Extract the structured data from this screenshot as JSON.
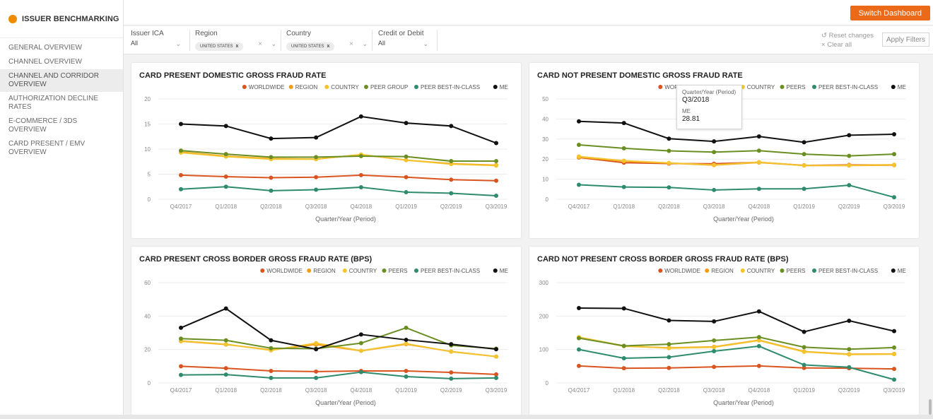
{
  "brand": {
    "label": "ISSUER BENCHMARKING",
    "color": "#f08a00"
  },
  "sidebar": {
    "items": [
      {
        "label": "GENERAL OVERVIEW"
      },
      {
        "label": "CHANNEL OVERVIEW"
      },
      {
        "label": "CHANNEL AND CORRIDOR OVERVIEW",
        "active": true
      },
      {
        "label": "AUTHORIZATION DECLINE RATES"
      },
      {
        "label": "E-COMMERCE / 3DS OVERVIEW"
      },
      {
        "label": "CARD PRESENT / EMV OVERVIEW"
      }
    ]
  },
  "header": {
    "switch_label": "Switch Dashboard",
    "accent": "#ea6a1a"
  },
  "filters": {
    "issuer_ica": {
      "label": "Issuer ICA",
      "value": "All"
    },
    "region": {
      "label": "Region",
      "chip": "UNITED STATES"
    },
    "country": {
      "label": "Country",
      "chip": "UNITED STATES"
    },
    "credit_debit": {
      "label": "Credit or Debit",
      "value": "All"
    },
    "reset_label": "Reset changes",
    "clear_label": "Clear all",
    "apply_label": "Apply Filters"
  },
  "series_colors": {
    "WORLDWIDE": "#d9541e",
    "REGION": "#f39c12",
    "COUNTRY": "#f4c430",
    "PEER GROUP": "#6b8e23",
    "PEERS": "#6b8e23",
    "PEER BEST-IN-CLASS": "#2e8b6e",
    "ME": "#111111"
  },
  "tooltip": {
    "header": "Quarter/Year (Period)",
    "period": "Q3/2018",
    "series": "ME",
    "value": "28.81"
  },
  "chart_data": [
    {
      "type": "line",
      "title": "CARD PRESENT DOMESTIC GROSS FRAUD RATE",
      "xlabel": "Quarter/Year (Period)",
      "ylabel": "",
      "ylim": [
        0,
        20
      ],
      "yticks": [
        0,
        5,
        10,
        15,
        20
      ],
      "categories": [
        "Q4/2017",
        "Q1/2018",
        "Q2/2018",
        "Q3/2018",
        "Q4/2018",
        "Q1/2019",
        "Q2/2019",
        "Q3/2019"
      ],
      "series": [
        {
          "name": "WORLDWIDE",
          "values": [
            4.8,
            4.5,
            4.3,
            4.4,
            4.8,
            4.4,
            3.9,
            3.7
          ]
        },
        {
          "name": "REGION",
          "values": [
            9.4,
            8.6,
            8.1,
            8.0,
            8.9,
            7.8,
            7.1,
            6.8
          ]
        },
        {
          "name": "COUNTRY",
          "values": [
            9.3,
            8.5,
            8.0,
            8.0,
            8.9,
            7.8,
            7.0,
            6.7
          ]
        },
        {
          "name": "PEER GROUP",
          "values": [
            9.7,
            9.0,
            8.4,
            8.4,
            8.6,
            8.5,
            7.6,
            7.6
          ]
        },
        {
          "name": "PEER BEST-IN-CLASS",
          "values": [
            2.0,
            2.5,
            1.7,
            1.9,
            2.4,
            1.4,
            1.2,
            0.7
          ]
        },
        {
          "name": "ME",
          "values": [
            15.0,
            14.6,
            12.1,
            12.3,
            16.5,
            15.2,
            14.6,
            11.2
          ]
        }
      ]
    },
    {
      "type": "line",
      "title": "CARD NOT PRESENT DOMESTIC GROSS FRAUD RATE",
      "xlabel": "Quarter/Year (Period)",
      "ylabel": "",
      "ylim": [
        0,
        50
      ],
      "yticks": [
        0,
        10,
        20,
        30,
        40,
        50
      ],
      "categories": [
        "Q4/2017",
        "Q1/2018",
        "Q2/2018",
        "Q3/2018",
        "Q4/2018",
        "Q1/2019",
        "Q2/2019",
        "Q3/2019"
      ],
      "series": [
        {
          "name": "WORLDWIDE",
          "values": [
            20.8,
            18.2,
            17.8,
            17.7,
            18.4,
            16.9,
            17.1,
            17.1
          ]
        },
        {
          "name": "REGION",
          "values": [
            21.0,
            19.0,
            18.0,
            17.0,
            18.3,
            16.8,
            16.8,
            17.0
          ]
        },
        {
          "name": "COUNTRY",
          "values": [
            21.3,
            19.2,
            18.1,
            17.1,
            18.5,
            16.8,
            16.9,
            17.2
          ]
        },
        {
          "name": "PEERS",
          "values": [
            27.1,
            25.4,
            24.1,
            23.5,
            24.2,
            22.5,
            21.6,
            22.5
          ]
        },
        {
          "name": "PEER BEST-IN-CLASS",
          "values": [
            7.2,
            6.1,
            5.9,
            4.6,
            5.2,
            5.2,
            7.0,
            1.0
          ]
        },
        {
          "name": "ME",
          "values": [
            38.8,
            38.0,
            30.2,
            28.81,
            31.3,
            28.4,
            31.9,
            32.4
          ]
        }
      ]
    },
    {
      "type": "line",
      "title": "CARD PRESENT CROSS BORDER GROSS FRAUD RATE (BPS)",
      "xlabel": "Quarter/Year (Period)",
      "ylabel": "",
      "ylim": [
        0,
        60
      ],
      "yticks": [
        0,
        20,
        40,
        60
      ],
      "categories": [
        "Q4/2017",
        "Q1/2018",
        "Q2/2018",
        "Q3/2018",
        "Q4/2018",
        "Q1/2019",
        "Q2/2019",
        "Q3/2019"
      ],
      "series": [
        {
          "name": "WORLDWIDE",
          "values": [
            10.0,
            8.8,
            7.2,
            6.8,
            7.2,
            7.2,
            6.3,
            5.1
          ]
        },
        {
          "name": "REGION",
          "values": [
            25.0,
            23.0,
            19.8,
            23.0,
            19.2,
            23.2,
            18.8,
            15.8
          ]
        },
        {
          "name": "COUNTRY",
          "values": [
            25.2,
            23.2,
            19.5,
            23.8,
            19.3,
            23.5,
            18.7,
            15.8
          ]
        },
        {
          "name": "PEERS",
          "values": [
            26.5,
            25.5,
            20.8,
            20.5,
            23.8,
            33.0,
            22.5,
            20.5
          ]
        },
        {
          "name": "PEER BEST-IN-CLASS",
          "values": [
            4.8,
            5.0,
            3.0,
            3.0,
            6.5,
            3.8,
            2.6,
            3.0
          ]
        },
        {
          "name": "ME",
          "values": [
            33.0,
            44.5,
            25.5,
            20.2,
            29.0,
            25.8,
            23.2,
            20.2
          ]
        }
      ]
    },
    {
      "type": "line",
      "title": "CARD NOT PRESENT CROSS BORDER GROSS FRAUD RATE (BPS)",
      "xlabel": "Quarter/Year (Period)",
      "ylabel": "",
      "ylim": [
        0,
        300
      ],
      "yticks": [
        0,
        100,
        200,
        300
      ],
      "categories": [
        "Q4/2017",
        "Q1/2018",
        "Q2/2018",
        "Q3/2018",
        "Q4/2018",
        "Q1/2019",
        "Q2/2019",
        "Q3/2019"
      ],
      "series": [
        {
          "name": "WORLDWIDE",
          "values": [
            51,
            44,
            45,
            48,
            51,
            45,
            44,
            42
          ]
        },
        {
          "name": "REGION",
          "values": [
            136,
            110,
            105,
            108,
            128,
            94,
            86,
            87
          ]
        },
        {
          "name": "COUNTRY",
          "values": [
            137,
            111,
            104,
            107,
            127,
            93,
            85,
            86
          ]
        },
        {
          "name": "PEERS",
          "values": [
            134,
            111,
            116,
            127,
            137,
            107,
            101,
            106
          ]
        },
        {
          "name": "PEER BEST-IN-CLASS",
          "values": [
            100,
            74,
            77,
            95,
            110,
            54,
            47,
            10
          ]
        },
        {
          "name": "ME",
          "values": [
            224,
            223,
            187,
            184,
            214,
            153,
            186,
            155
          ]
        }
      ]
    }
  ]
}
